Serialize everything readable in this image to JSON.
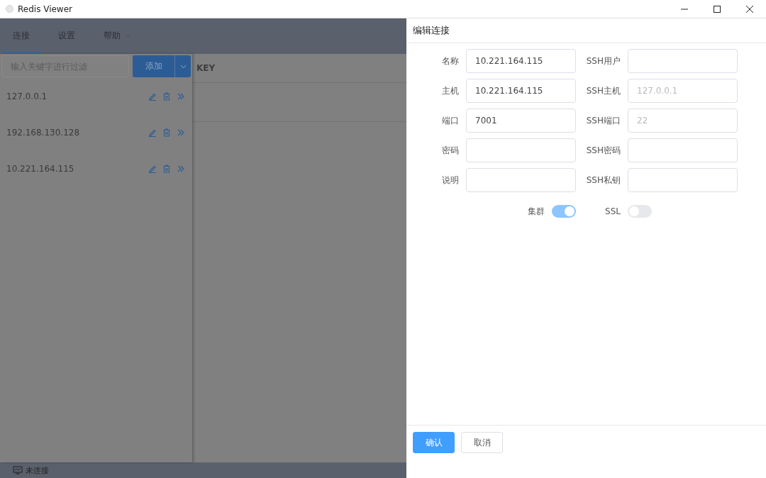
{
  "window": {
    "title": "Redis Viewer"
  },
  "nav": {
    "tabs": [
      {
        "label": "连接",
        "selected": true,
        "dropdown": false
      },
      {
        "label": "设置",
        "selected": false,
        "dropdown": false
      },
      {
        "label": "帮助",
        "selected": false,
        "dropdown": true
      }
    ]
  },
  "sidebar": {
    "filter": {
      "placeholder": "输入关键字进行过滤"
    },
    "add_button": "添加",
    "connections": [
      {
        "name": "127.0.0.1"
      },
      {
        "name": "192.168.130.128"
      },
      {
        "name": "10.221.164.115"
      }
    ]
  },
  "main": {
    "columns": [
      "KEY"
    ]
  },
  "status_bar": {
    "text": "未连接"
  },
  "drawer": {
    "title": "编辑连接",
    "rows": [
      {
        "left": {
          "label": "名称",
          "value": "10.221.164.115"
        },
        "right": {
          "label": "SSH用户"
        }
      },
      {
        "left": {
          "label": "主机",
          "value": "10.221.164.115"
        },
        "right": {
          "label": "SSH主机",
          "placeholder": "127.0.0.1"
        }
      },
      {
        "left": {
          "label": "端口",
          "value": "7001"
        },
        "right": {
          "label": "SSH端口",
          "placeholder": "22"
        }
      },
      {
        "left": {
          "label": "密码"
        },
        "right": {
          "label": "SSH密码"
        }
      },
      {
        "left": {
          "label": "说明"
        },
        "right": {
          "label": "SSH私钥"
        }
      }
    ],
    "switches": [
      {
        "label": "集群",
        "on": true
      },
      {
        "label": "SSL",
        "on": false
      }
    ],
    "buttons": [
      {
        "label": "确认",
        "kind": "primary"
      },
      {
        "label": "取消",
        "kind": "default"
      }
    ]
  }
}
